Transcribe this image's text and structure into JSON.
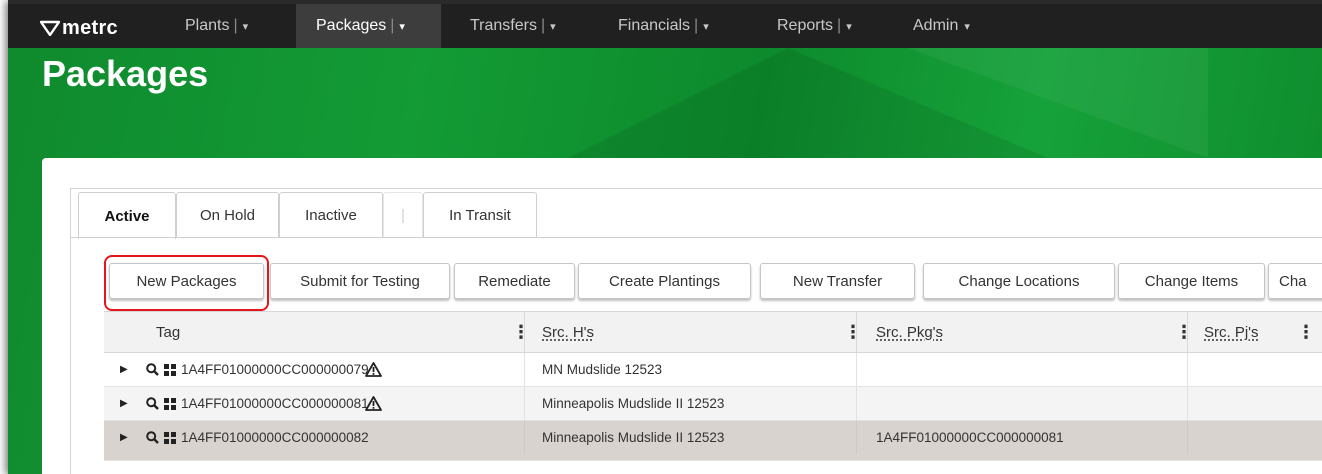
{
  "app": {
    "logo_text": "metrc"
  },
  "nav": {
    "items": [
      {
        "label": "Plants",
        "sep": "|",
        "caret": "▾"
      },
      {
        "label": "Packages",
        "sep": "|",
        "caret": "▾"
      },
      {
        "label": "Transfers",
        "sep": "|",
        "caret": "▾"
      },
      {
        "label": "Financials",
        "sep": "|",
        "caret": "▾"
      },
      {
        "label": "Reports",
        "sep": "|",
        "caret": "▾"
      },
      {
        "label": "Admin",
        "caret": "▾"
      }
    ]
  },
  "page": {
    "title": "Packages"
  },
  "tabs": [
    {
      "label": "Active"
    },
    {
      "label": "On Hold"
    },
    {
      "label": "Inactive"
    },
    {
      "label": "|"
    },
    {
      "label": "In Transit"
    }
  ],
  "toolbar": {
    "buttons": [
      {
        "label": "New Packages"
      },
      {
        "label": "Submit for Testing"
      },
      {
        "label": "Remediate"
      },
      {
        "label": "Create Plantings"
      },
      {
        "label": "New Transfer"
      },
      {
        "label": "Change Locations"
      },
      {
        "label": "Change Items"
      },
      {
        "label": "Cha"
      }
    ]
  },
  "grid": {
    "columns": [
      {
        "label": "Tag",
        "menu": "⋮"
      },
      {
        "label": "Src. H's",
        "menu": "⋮"
      },
      {
        "label": "Src. Pkg's",
        "menu": "⋮"
      },
      {
        "label": "Src. Pj's",
        "menu": "⋮"
      }
    ],
    "rows": [
      {
        "tag": "1A4FF01000000CC000000079",
        "src_h": "MN Mudslide 12523",
        "src_pkg": "",
        "src_pj": ""
      },
      {
        "tag": "1A4FF01000000CC000000081",
        "src_h": "Minneapolis Mudslide II 12523",
        "src_pkg": "",
        "src_pj": ""
      },
      {
        "tag": "1A4FF01000000CC000000082",
        "src_h": "Minneapolis Mudslide II 12523",
        "src_pkg": "1A4FF01000000CC000000081",
        "src_pj": ""
      }
    ]
  },
  "colors": {
    "nav_bg": "#202020",
    "hero_green": "#139b35",
    "highlight": "#e4161c",
    "selected_row": "#d9d3cf"
  },
  "icons": {
    "expander": "▶",
    "search": "search-icon",
    "barcode": "barcode-icon",
    "warning": "warning-icon"
  }
}
